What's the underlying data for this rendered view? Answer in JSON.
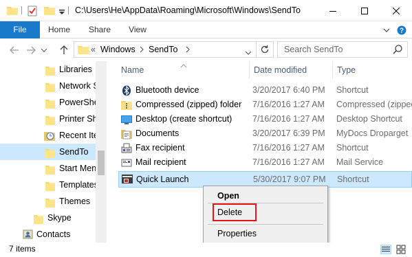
{
  "titlebar": {
    "path": "C:\\Users\\He\\AppData\\Roaming\\Microsoft\\Windows\\SendTo"
  },
  "ribbon": {
    "tabs": [
      "File",
      "Home",
      "Share",
      "View"
    ]
  },
  "address": {
    "overflow": "«",
    "segments": [
      "Windows",
      "SendTo"
    ],
    "search_placeholder": "Search SendTo"
  },
  "navpane": {
    "items": [
      {
        "label": "Libraries",
        "icon": "folder-icon"
      },
      {
        "label": "Network S",
        "icon": "folder-icon"
      },
      {
        "label": "PowerShe",
        "icon": "folder-icon"
      },
      {
        "label": "Printer Sh",
        "icon": "folder-icon"
      },
      {
        "label": "Recent Ite",
        "icon": "recent-icon"
      },
      {
        "label": "SendTo",
        "icon": "folder-icon",
        "selected": true
      },
      {
        "label": "Start Men",
        "icon": "folder-icon"
      },
      {
        "label": "Templates",
        "icon": "folder-icon"
      },
      {
        "label": "Themes",
        "icon": "folder-icon"
      },
      {
        "label": "Skype",
        "icon": "folder-icon"
      },
      {
        "label": "Contacts",
        "icon": "contacts-icon"
      }
    ]
  },
  "columns": {
    "name": "Name",
    "date": "Date modified",
    "type": "Type"
  },
  "files": [
    {
      "name": "Bluetooth device",
      "date": "3/20/2017 6:40 PM",
      "type": "Shortcut",
      "icon": "bluetooth-icon"
    },
    {
      "name": "Compressed (zipped) folder",
      "date": "7/16/2016 1:27 AM",
      "type": "Compressed (zipped)",
      "icon": "zip-folder-icon"
    },
    {
      "name": "Desktop (create shortcut)",
      "date": "7/16/2016 1:27 AM",
      "type": "Desktop Shortcut",
      "icon": "desktop-icon"
    },
    {
      "name": "Documents",
      "date": "3/20/2017 6:39 PM",
      "type": "MyDocs Droparget",
      "icon": "documents-icon"
    },
    {
      "name": "Fax recipient",
      "date": "7/16/2016 1:27 AM",
      "type": "Shortcut",
      "icon": "fax-icon"
    },
    {
      "name": "Mail recipient",
      "date": "7/16/2016 1:27 AM",
      "type": "Mail Service",
      "icon": "mail-icon"
    },
    {
      "name": "Quick Launch",
      "date": "5/30/2017 9:07 PM",
      "type": "Shortcut",
      "icon": "quick-launch-icon",
      "selected": true
    }
  ],
  "context_menu": {
    "open": "Open",
    "delete": "Delete",
    "properties": "Properties"
  },
  "status": {
    "count": "7 items"
  },
  "colors": {
    "accent": "#1979ca",
    "selection": "#cce8ff",
    "highlight_box": "#e8141c"
  }
}
